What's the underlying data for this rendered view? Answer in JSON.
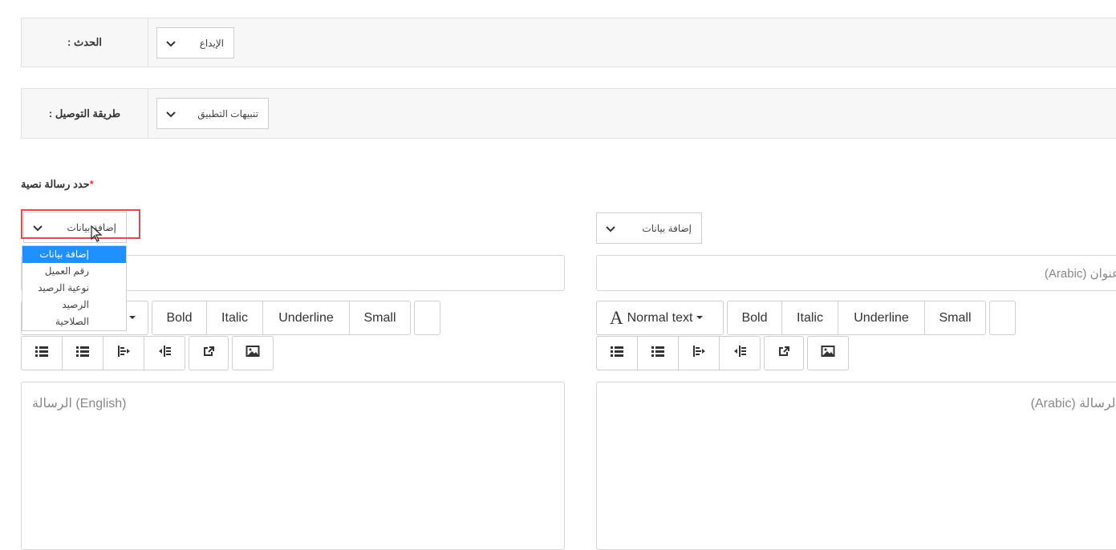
{
  "event_row": {
    "label": ": الحدث",
    "select_value": "الإيداع"
  },
  "delivery_row": {
    "label": ": طريقة التوصيل",
    "select_value": "تنبيهات التطبيق"
  },
  "sms_section": {
    "title": "حدد رسالة نصية",
    "required_mark": "*"
  },
  "left_panel": {
    "add_data_select": "إضافة بيانات",
    "dropdown_options": [
      "إضافة بيانات",
      "رقم العميل",
      "نوعية الرصيد",
      "الرصيد",
      "الصلاحية"
    ],
    "toolbar": {
      "bold": "Bold",
      "italic": "Italic",
      "underline": "Underline",
      "small": "Small"
    },
    "message_placeholder": "الرسالة (English)"
  },
  "right_panel": {
    "add_data_select": "إضافة بيانات",
    "title_placeholder": "عنوان (Arabic)",
    "toolbar": {
      "font_glyph": "A",
      "normal_text": "Normal text",
      "bold": "Bold",
      "italic": "Italic",
      "underline": "Underline",
      "small": "Small"
    },
    "message_placeholder": "الرسالة (Arabic)"
  },
  "icons": [
    "chevron-down-icon",
    "list-unordered-icon",
    "list-ordered-icon",
    "outdent-icon",
    "indent-icon",
    "link-icon",
    "image-icon",
    "caret-down-icon",
    "cursor-icon"
  ]
}
